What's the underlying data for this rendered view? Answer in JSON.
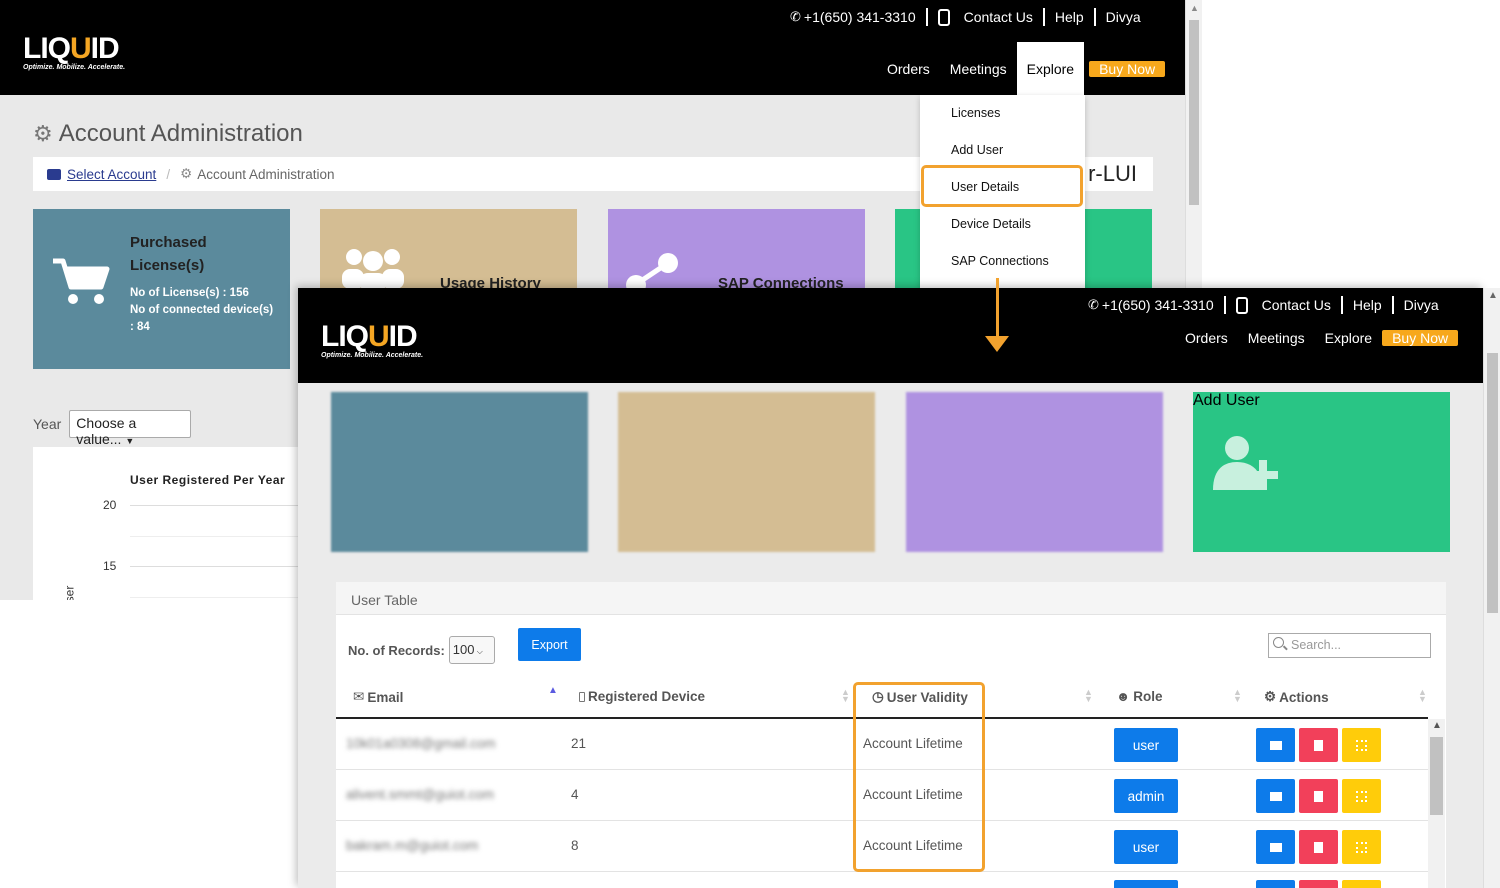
{
  "header": {
    "phone": "+1(650) 341-3310",
    "contact_us": "Contact Us",
    "help": "Help",
    "user": "Divya",
    "nav": [
      "Orders",
      "Meetings",
      "Explore"
    ],
    "buy_now": "Buy Now",
    "logo_text": "LIQUID",
    "logo_tagline": "Optimize. Mobilize. Accelerate."
  },
  "page": {
    "title": "Account Administration",
    "breadcrumb": [
      "Select Account",
      "Account Administration"
    ],
    "account_name": "r-LUI"
  },
  "tiles": {
    "purchased_title": "Purchased License(s)",
    "purchased_line1": "No of License(s) : 156",
    "purchased_line2": "No of connected device(s) : 84",
    "usage_history": "Usage History",
    "sap_connections": "SAP Connections",
    "add_user": "Add User"
  },
  "filters": {
    "year_label": "Year",
    "year_value": "Choose a value..."
  },
  "chart": {
    "title": "User Registered Per Year",
    "ylabel_fragment": "ser",
    "ticks": [
      "20",
      "15"
    ]
  },
  "explore_menu": {
    "items": [
      "Licenses",
      "Add User",
      "User Details",
      "Device Details",
      "SAP Connections"
    ],
    "highlighted": "User Details"
  },
  "user_table": {
    "title": "User Table",
    "records_label": "No. of Records:",
    "records_value": "100",
    "export_label": "Export",
    "search_placeholder": "Search...",
    "columns": [
      "Email",
      "Registered Device",
      "User Validity",
      "Role",
      "Actions"
    ],
    "rows": [
      {
        "email": "10k01a0308@gmail.com",
        "devices": "21",
        "validity": "Account Lifetime",
        "role": "user"
      },
      {
        "email": "alivent.smmt@guiot.com",
        "devices": "4",
        "validity": "Account Lifetime",
        "role": "admin"
      },
      {
        "email": "bakram.m@guiot.com",
        "devices": "8",
        "validity": "Account Lifetime",
        "role": "user"
      }
    ]
  },
  "colors": {
    "accent": "#f2a22e",
    "tile_blue": "#5b8a9c",
    "tile_tan": "#d4bd93",
    "tile_purple": "#af92e1",
    "tile_green": "#29c585",
    "button_blue": "#0d7bea"
  }
}
